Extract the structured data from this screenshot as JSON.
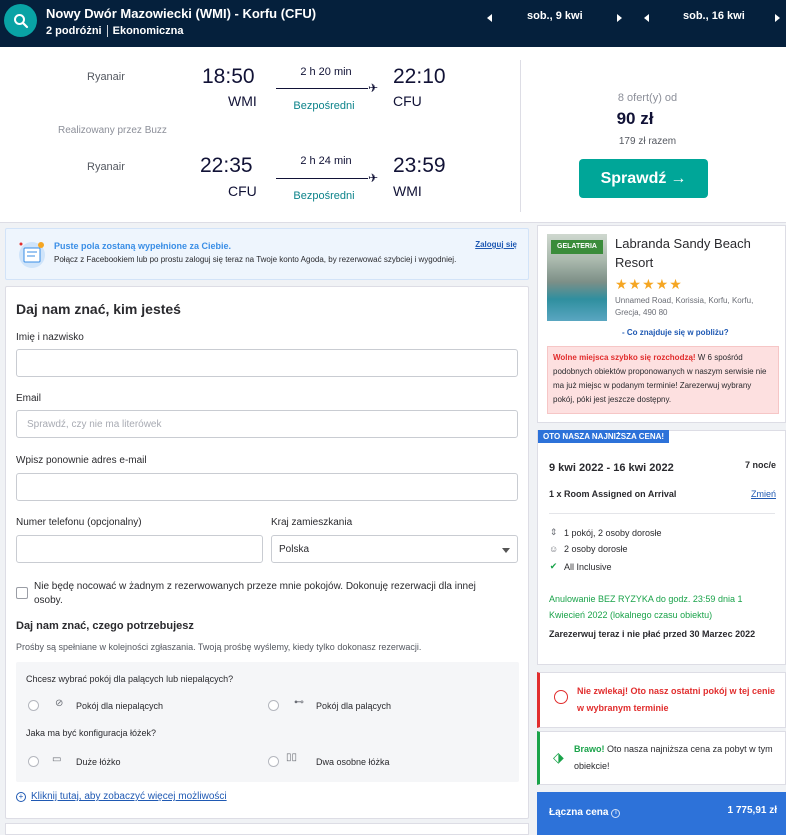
{
  "header": {
    "route": "Nowy Dwór Mazowiecki (WMI) - Korfu (CFU)",
    "passengers": "2 podróżni",
    "cabin": "Ekonomiczna",
    "depart_date": "sob., 9 kwi",
    "return_date": "sob., 16 kwi"
  },
  "flight": {
    "outbound": {
      "airline": "Ryanair",
      "dep_time": "18:50",
      "dep_code": "WMI",
      "duration": "2 h 20 min",
      "stops": "Bezpośredni",
      "arr_time": "22:10",
      "arr_code": "CFU"
    },
    "operated_by": "Realizowany przez Buzz",
    "inbound": {
      "airline": "Ryanair",
      "dep_time": "22:35",
      "dep_code": "CFU",
      "duration": "2 h 24 min",
      "stops": "Bezpośredni",
      "arr_time": "23:59",
      "arr_code": "WMI"
    },
    "offers": "8 ofert(y) od",
    "price": "90 zł",
    "total": "179 zł razem",
    "cta": "Sprawdź"
  },
  "facebook": {
    "title": "Puste pola zostaną wypełnione za Ciebie.",
    "text": "Połącz z Facebookiem lub po prostu zaloguj się teraz na Twoje konto Agoda, by rezerwować szybciej i wygodniej.",
    "login": "Zaloguj się"
  },
  "form": {
    "title": "Daj nam znać, kim jesteś",
    "name_label": "Imię i nazwisko",
    "email_label": "Email",
    "email_placeholder": "Sprawdź, czy nie ma literówek",
    "email2_label": "Wpisz ponownie adres e-mail",
    "phone_label": "Numer telefonu (opcjonalny)",
    "country_label": "Kraj zamieszkania",
    "country_value": "Polska",
    "not_staying": "Nie będę nocować w żadnym z rezerwowanych przeze mnie pokojów. Dokonuję rezerwacji dla innej osoby.",
    "needs_title": "Daj nam znać, czego potrzebujesz",
    "needs_note": "Prośby są spełniane w kolejności zgłaszania. Twoją prośbę wyślemy, kiedy tylko dokonasz rezerwacji.",
    "q_smoking": "Chcesz wybrać pokój dla palących lub niepalących?",
    "opt_nonsmoking": "Pokój dla niepalących",
    "opt_smoking": "Pokój dla palących",
    "q_bed": "Jaka ma być konfiguracja łóżek?",
    "opt_large_bed": "Duże łóżko",
    "opt_twin": "Dwa osobne łóżka",
    "more": "Kliknij tutaj, aby zobaczyć więcej możliwości"
  },
  "hotel": {
    "image_sign": "GELATERIA",
    "name": "Labranda Sandy Beach Resort",
    "stars": "★★★★★",
    "address": "Unnamed Road, Korissia, Korfu, Korfu, Grecja, 490 80",
    "nearby": "- Co znajduje się w pobliżu?",
    "warn_bold": "Wolne miejsca szybko się rozchodzą!",
    "warn_text": " W 6 spośród podobnych obiektów proponowanych w naszym serwisie nie ma już miejsc w podanym terminie! Zarezerwuj wybrany pokój, póki jest jeszcze dostępny."
  },
  "stay": {
    "badge": "OTO NASZA NAJNIŻSZA CENA!",
    "dates": "9 kwi 2022 - 16 kwi 2022",
    "nights": "7 noc/e",
    "room": "1 x Room Assigned on Arrival",
    "change": "Zmień",
    "occupancy": "1 pokój, 2 osoby dorosłe",
    "adults": "2 osoby dorosłe",
    "board": "All Inclusive",
    "free_cancel": "Anulowanie BEZ RYZYKA do godz. 23:59 dnia 1 Kwiecień 2022 (lokalnego czasu obiektu)",
    "pay_later": "Zarezerwuj teraz i nie płać przed 30 Marzec 2022"
  },
  "alerts": {
    "last_room": "Nie zwlekaj! Oto nasz ostatni pokój w tej cenie w wybranym terminie",
    "bravo_bold": "Brawo!",
    "bravo_text": " Oto nasza najniższa cena za pobyt w tym obiekcie!"
  },
  "total": {
    "label": "Łączna cena",
    "value": "1 775,91 zł"
  },
  "colors": {
    "header": "#05203c",
    "teal": "#00a698",
    "blue": "#2d72d9",
    "red": "#e12d2d",
    "green": "#1aa34a"
  }
}
